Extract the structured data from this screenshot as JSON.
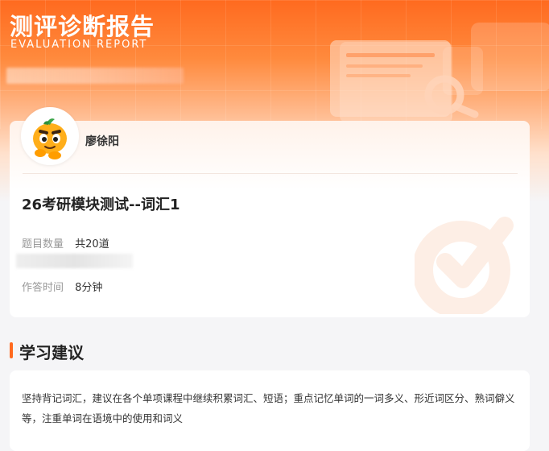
{
  "header": {
    "title": "测评诊断报告",
    "subtitle": "EVALUATION REPORT"
  },
  "user": {
    "name": "廖徐阳",
    "avatar_icon": "orange-mascot-icon"
  },
  "test": {
    "title": "26考研模块测试--词汇1",
    "question_count_label": "题目数量",
    "question_count_value": "共20道",
    "time_label": "作答时间",
    "time_value": "8分钟"
  },
  "advice": {
    "section_title": "学习建议",
    "text": "坚持背记词汇，建议在各个单项课程中继续积累词汇、短语；重点记忆单词的一词多义、形近词区分、熟词僻义等，注重单词在语境中的使用和词义"
  },
  "colors": {
    "accent": "#ff6a1f",
    "header_gradient_top": "#ff6a1f",
    "page_background": "#f5f5f7"
  }
}
